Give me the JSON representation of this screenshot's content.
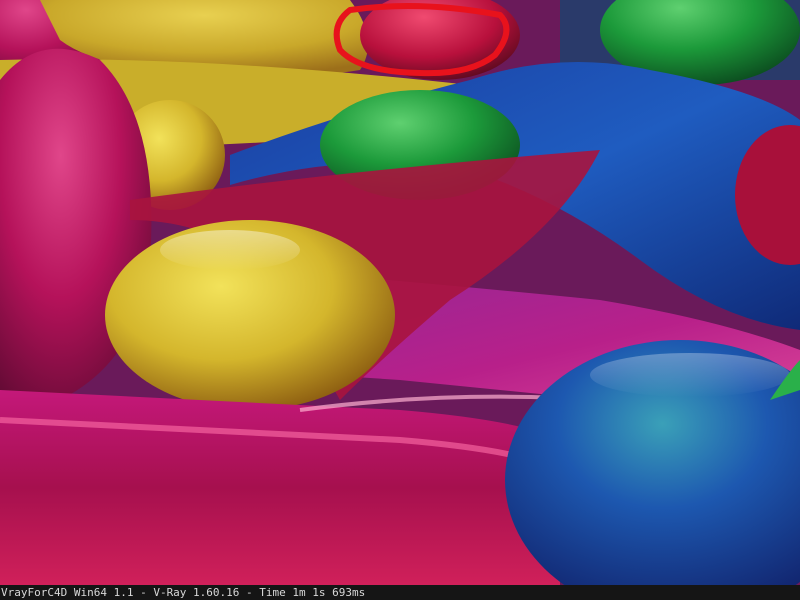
{
  "status_bar": {
    "text": "VrayForC4D Win64 1.1 - V-Ray 1.60.16 - Time 1m 1s 693ms"
  },
  "colors": {
    "magenta": "#c2185b",
    "yellow": "#d8c232",
    "blue": "#1e4fa8",
    "green": "#1e9a3a",
    "annotation_red": "#e8121c",
    "status_bar_bg": "#151515",
    "status_bar_text": "#d8d8d8"
  }
}
